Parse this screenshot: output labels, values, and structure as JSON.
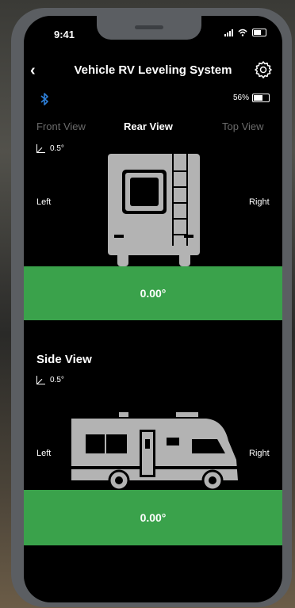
{
  "status": {
    "time": "9:41"
  },
  "header": {
    "title": "Vehicle RV Leveling System"
  },
  "device": {
    "battery": "56%"
  },
  "tabs": [
    {
      "label": "Front View",
      "active": false
    },
    {
      "label": "Rear View",
      "active": true
    },
    {
      "label": "Top View",
      "active": false
    }
  ],
  "rear": {
    "angle": "0.5°",
    "left": "Left",
    "right": "Right",
    "reading": "0.00°"
  },
  "side": {
    "title": "Side View",
    "angle": "0.5°",
    "left": "Left",
    "right": "Right",
    "reading": "0.00°"
  },
  "colors": {
    "accent_green": "#3aa24b",
    "vehicle_gray": "#b3b3b3"
  }
}
